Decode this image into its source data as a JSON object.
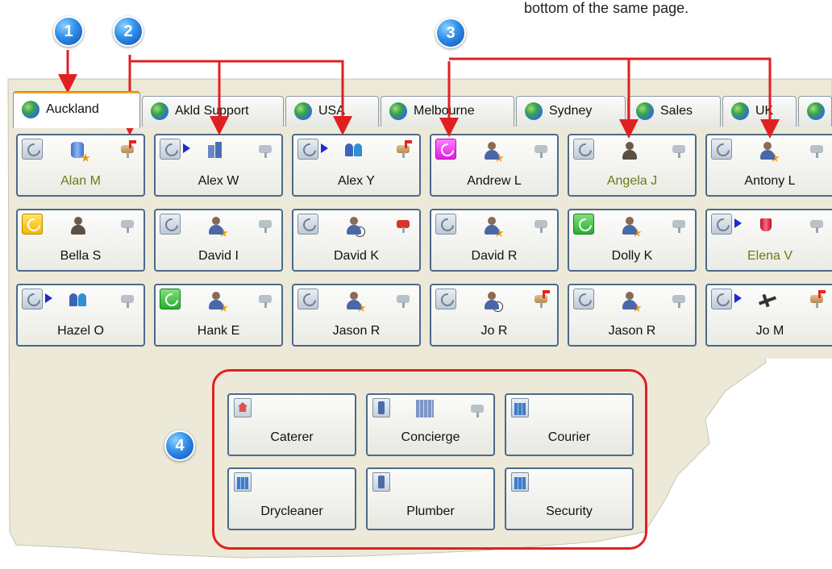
{
  "caption": "bottom of the same page.",
  "callouts": [
    "1",
    "2",
    "3",
    "4"
  ],
  "tabs": [
    {
      "label": "Auckland",
      "active": true
    },
    {
      "label": "Akld Support"
    },
    {
      "label": "USA"
    },
    {
      "label": "Melbourne"
    },
    {
      "label": "Sydney"
    },
    {
      "label": "Sales"
    },
    {
      "label": "UK"
    }
  ],
  "contacts": [
    {
      "name": "Alan M",
      "phone": "default",
      "status": "db-star",
      "mail": "active",
      "name_color": "green"
    },
    {
      "name": "Alex W",
      "phone": "default",
      "arrow": true,
      "status": "building",
      "mail": "idle"
    },
    {
      "name": "Alex Y",
      "phone": "default",
      "arrow": true,
      "status": "group",
      "mail": "active"
    },
    {
      "name": "Andrew L",
      "phone": "magenta",
      "status": "person-star",
      "mail": "idle"
    },
    {
      "name": "Angela J",
      "phone": "default",
      "status": "headset",
      "mail": "idle",
      "name_color": "green"
    },
    {
      "name": "Antony L",
      "phone": "default",
      "status": "person-star",
      "mail": "idle"
    },
    {
      "name": "Bella S",
      "phone": "yellow",
      "status": "headset",
      "mail": "idle"
    },
    {
      "name": "David I",
      "phone": "default",
      "status": "person-star",
      "mail": "idle"
    },
    {
      "name": "David K",
      "phone": "default",
      "status": "person-clock",
      "mail": "alert"
    },
    {
      "name": "David R",
      "phone": "default",
      "status": "person-star",
      "mail": "idle"
    },
    {
      "name": "Dolly K",
      "phone": "green",
      "status": "person-star",
      "mail": "idle"
    },
    {
      "name": "Elena V",
      "phone": "default",
      "arrow": true,
      "status": "cup",
      "mail": "idle",
      "name_color": "green"
    },
    {
      "name": "Hazel O",
      "phone": "default",
      "arrow": true,
      "status": "group",
      "mail": "idle"
    },
    {
      "name": "Hank E",
      "phone": "green",
      "status": "person-star",
      "mail": "idle"
    },
    {
      "name": "Jason R",
      "phone": "default",
      "status": "person-star",
      "mail": "idle"
    },
    {
      "name": "Jo R",
      "phone": "default",
      "status": "person-clock",
      "mail": "active"
    },
    {
      "name": "Jason R",
      "phone": "default",
      "status": "person-star",
      "mail": "idle"
    },
    {
      "name": "Jo M",
      "phone": "default",
      "arrow": true,
      "status": "plane",
      "mail": "active"
    }
  ],
  "services": [
    {
      "name": "Caterer",
      "icon": "house-icon"
    },
    {
      "name": "Concierge",
      "icon": "mobile-icon",
      "extra": "building-icon",
      "mail": true
    },
    {
      "name": "Courier",
      "icon": "building-icon"
    },
    {
      "name": "Drycleaner",
      "icon": "building-icon"
    },
    {
      "name": "Plumber",
      "icon": "mobile-icon"
    },
    {
      "name": "Security",
      "icon": "building-icon"
    }
  ],
  "colors": {
    "annotation_red": "#e02020",
    "callout_blue": "#2f8ee8",
    "card_border": "#4c6a8a",
    "active_tab_accent": "#f4a623",
    "panel_background": "#ece9d8"
  }
}
